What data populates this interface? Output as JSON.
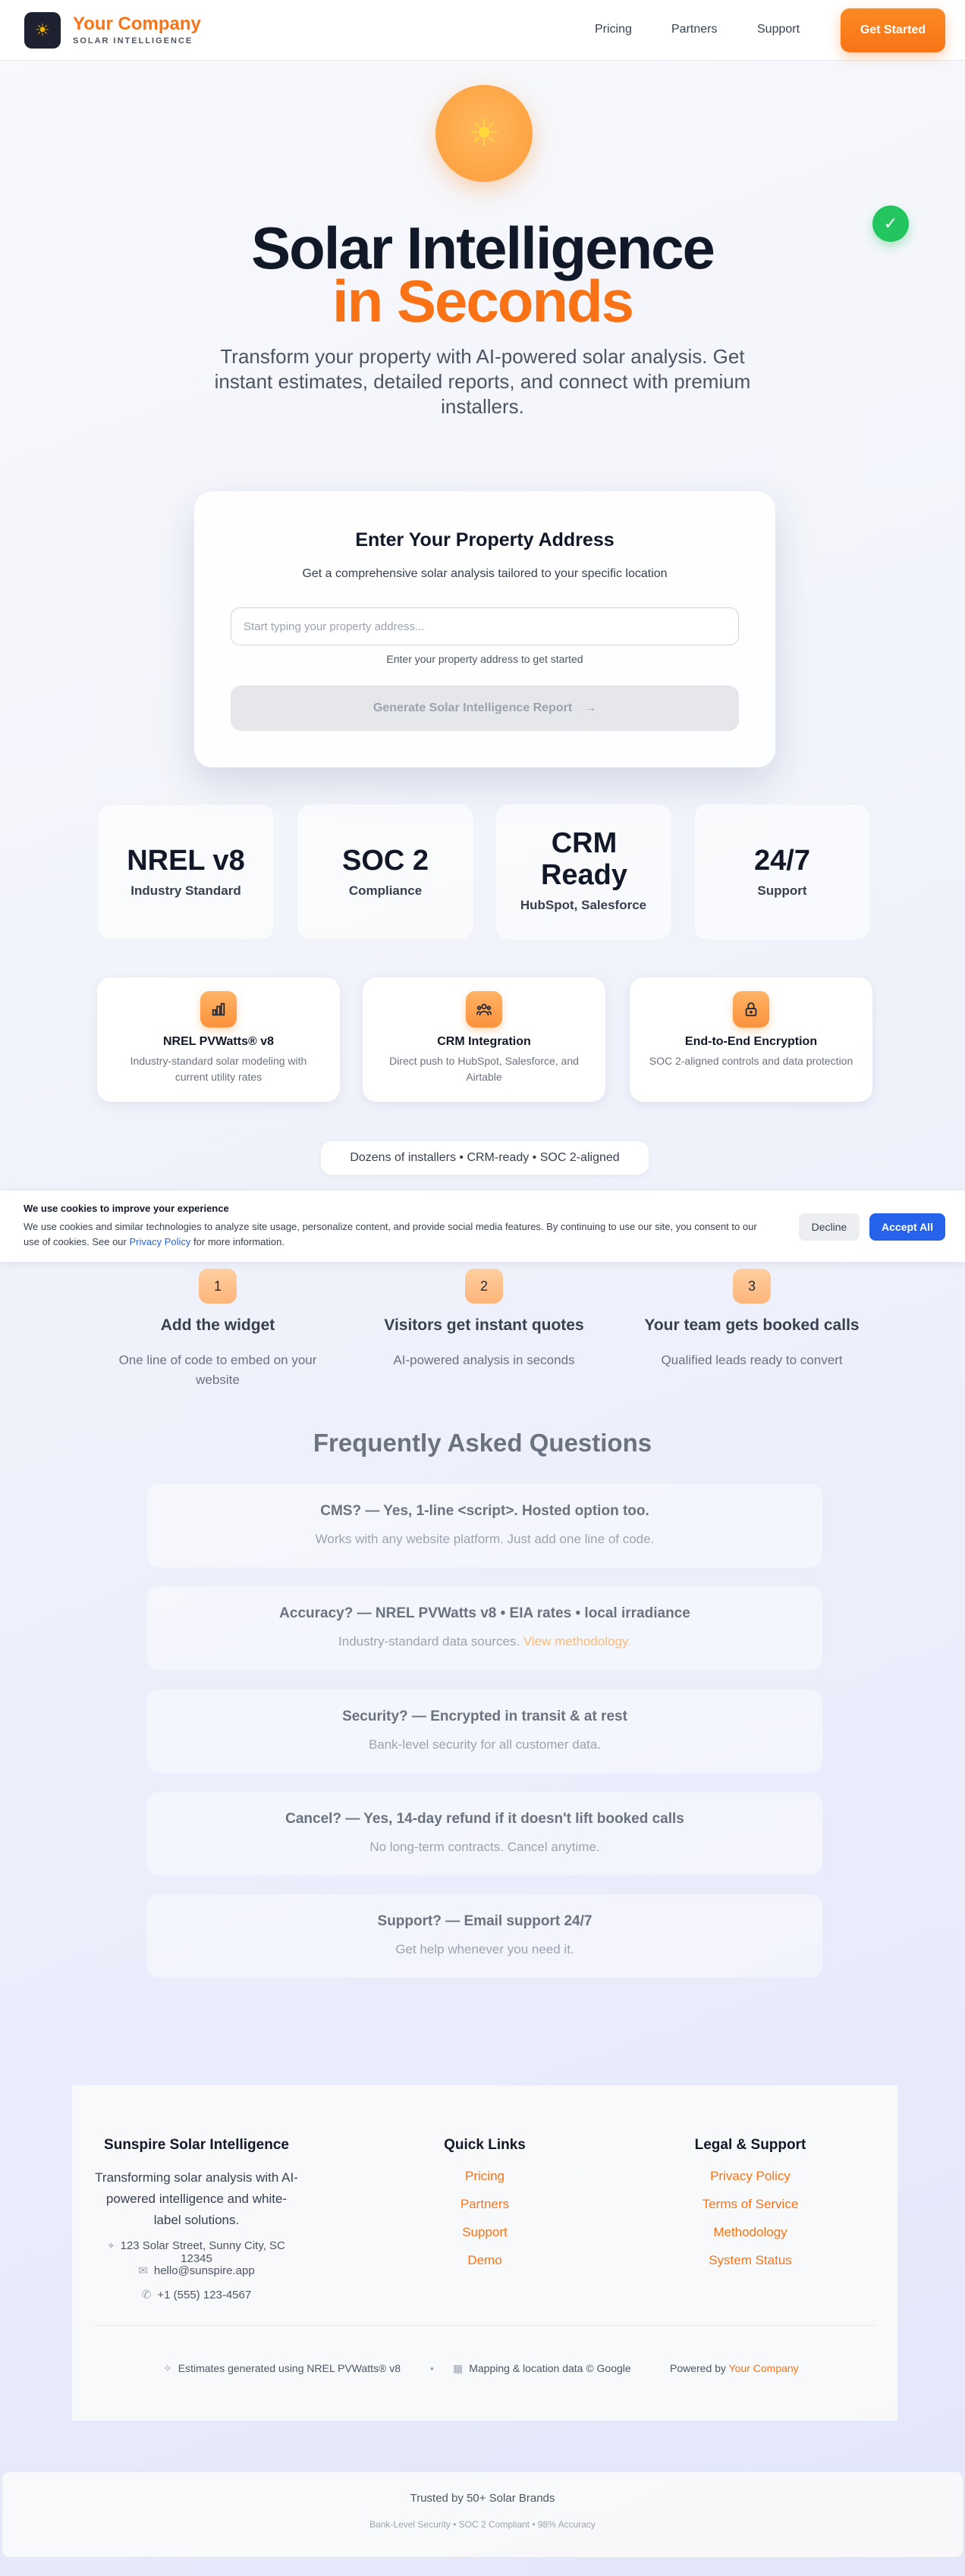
{
  "header": {
    "logo_icon": "☀",
    "brand_name": "Your Company",
    "brand_tagline": "SOLAR INTELLIGENCE",
    "nav": [
      "Pricing",
      "Partners",
      "Support"
    ],
    "cta_label": "Get Started",
    "accent_color": "#f97316"
  },
  "hero": {
    "sun_icon": "☀",
    "check_icon": "✓",
    "title_line1": "Solar Intelligence",
    "title_line2": "in Seconds",
    "subtitle": "Transform your property with AI-powered solar analysis. Get instant estimates, detailed reports, and connect with premium installers."
  },
  "address_card": {
    "title": "Enter Your Property Address",
    "subtitle": "Get a comprehensive solar analysis tailored to your specific location",
    "input_value": "",
    "input_placeholder": "Start typing your property address...",
    "helper_text": "Enter your property address to get started",
    "button_label": "Generate Solar Intelligence Report",
    "button_icon": "→"
  },
  "stats": [
    {
      "value": "NREL v8",
      "label": "Industry Standard"
    },
    {
      "value": "SOC 2",
      "label": "Compliance"
    },
    {
      "value": "CRM Ready",
      "label": "HubSpot, Salesforce"
    },
    {
      "value": "24/7",
      "label": "Support"
    }
  ],
  "features": [
    {
      "icon": "bar-chart-icon",
      "title": "NREL PVWatts® v8",
      "desc": "Industry-standard solar modeling with current utility rates"
    },
    {
      "icon": "crm-icon",
      "title": "CRM Integration",
      "desc": "Direct push to HubSpot, Salesforce, and Airtable"
    },
    {
      "icon": "lock-icon",
      "title": "End-to-End Encryption",
      "desc": "SOC 2-aligned controls and data protection"
    }
  ],
  "pill_text": "Dozens of installers • CRM-ready • SOC 2-aligned",
  "cookie": {
    "title": "We use cookies to improve your experience",
    "text": "We use cookies and similar technologies to analyze site usage, personalize content, and provide social media features. By continuing to use our site, you consent to our use of cookies. See our",
    "link_label": "Privacy Policy",
    "text_end": "for more information.",
    "decline_label": "Decline",
    "accept_label": "Accept All",
    "accept_color": "#2563eb"
  },
  "steps": [
    {
      "num": "1",
      "title": "Add the widget",
      "desc": "One line of code to embed on your website"
    },
    {
      "num": "2",
      "title": "Visitors get instant quotes",
      "desc": "AI-powered analysis in seconds"
    },
    {
      "num": "3",
      "title": "Your team gets booked calls",
      "desc": "Qualified leads ready to convert"
    }
  ],
  "faq": {
    "heading": "Frequently Asked Questions",
    "items": [
      {
        "q": "CMS? — Yes, 1-line <script>. Hosted option too.",
        "a": "Works with any website platform. Just add one line of code.",
        "link": ""
      },
      {
        "q": "Accuracy? — NREL PVWatts v8 • EIA rates • local irradiance",
        "a": "Industry-standard data sources.",
        "link": "View methodology."
      },
      {
        "q": "Security? — Encrypted in transit & at rest",
        "a": "Bank-level security for all customer data.",
        "link": ""
      },
      {
        "q": "Cancel? — Yes, 14-day refund if it doesn't lift booked calls",
        "a": "No long-term contracts. Cancel anytime.",
        "link": ""
      },
      {
        "q": "Support? — Email support 24/7",
        "a": "Get help whenever you need it.",
        "link": ""
      }
    ]
  },
  "footer": {
    "col1_title": "Sunspire Solar Intelligence",
    "col1_desc": "Transforming solar analysis with AI-powered intelligence and white-label solutions.",
    "address": "123 Solar Street, Sunny City, SC 12345",
    "email": "hello@sunspire.app",
    "phone": "+1 (555) 123-4567",
    "col2_title": "Quick Links",
    "quick_links": [
      "Pricing",
      "Partners",
      "Support",
      "Demo"
    ],
    "col3_title": "Legal & Support",
    "legal_links": [
      "Privacy Policy",
      "Terms of Service",
      "Methodology",
      "System Status"
    ],
    "bottom_nrel": "Estimates generated using NREL PVWatts® v8",
    "bottom_sep": "•",
    "bottom_maps": "Mapping & location data © Google",
    "bottom_powered": "Powered by",
    "bottom_brand": "Your Company"
  },
  "trusted": {
    "title": "Trusted by 50+ Solar Brands",
    "subtitle": "Bank-Level Security • SOC 2 Compliant • 98% Accuracy"
  }
}
